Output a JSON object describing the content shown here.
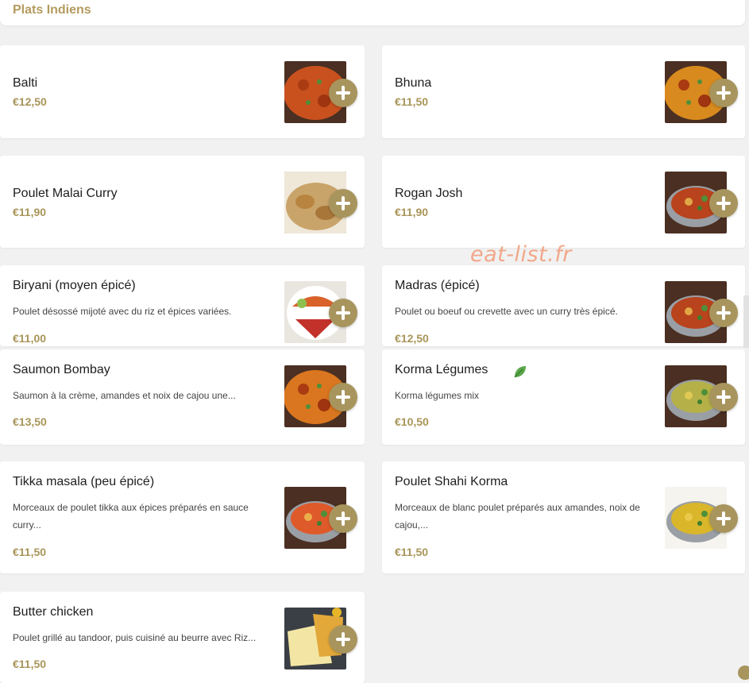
{
  "section": {
    "title": "Plats Indiens"
  },
  "watermark": "eat-list.fr",
  "dishes": [
    {
      "name": "Balti",
      "description": "",
      "price": "€12,50",
      "image": "curry-dish",
      "accent": "#c9511e"
    },
    {
      "name": "Bhuna",
      "description": "",
      "price": "€11,50",
      "image": "curry-dish",
      "accent": "#d88a1e"
    },
    {
      "name": "Poulet Malai Curry",
      "description": "",
      "price": "€11,90",
      "image": "creamy-chicken",
      "accent": "#c9a46a"
    },
    {
      "name": "Rogan Josh",
      "description": "",
      "price": "€11,90",
      "image": "curry-bowl",
      "accent": "#b8431c"
    },
    {
      "name": "Biryani (moyen épicé)",
      "description": "Poulet désossé mijoté avec du riz et épices variées.",
      "price": "€11,00",
      "image": "biryani-plate",
      "accent": "#d9622a"
    },
    {
      "name": "Madras (épicé)",
      "description": "Poulet ou boeuf ou crevette  avec un curry très épicé.",
      "price": "€12,50",
      "image": "curry-bowl",
      "accent": "#b8431c"
    },
    {
      "name": "Saumon Bombay",
      "description": "Saumon à la crème, amandes et noix de cajou une...",
      "price": "€13,50",
      "image": "salmon-curry",
      "accent": "#d9761f"
    },
    {
      "name": "Korma Légumes",
      "description": "Korma légumes mix",
      "price": "€10,50",
      "image": "korma-bowl",
      "accent": "#b5b148"
    },
    {
      "name": "Tikka masala (peu épicé)",
      "description": "Morceaux de poulet tikka aux épices préparés en sauce curry...",
      "price": "€11,50",
      "image": "tikka-bowl",
      "accent": "#de5a2a"
    },
    {
      "name": "Poulet Shahi Korma",
      "description": "Morceaux de blanc poulet préparés aux amandes, noix de cajou,...",
      "price": "€11,50",
      "image": "korma-pan",
      "accent": "#d9b62a"
    },
    {
      "name": "Butter chicken",
      "description": "Poulet grillé au tandoor, puis cuisiné au beurre avec Riz...",
      "price": "€11,50",
      "image": "butter-chicken",
      "accent": "#e2a83a"
    }
  ],
  "icons": {
    "add": "plus-icon",
    "vegetarian": "leaf-icon"
  },
  "colors": {
    "brand": "#a8955d",
    "price": "#a89558",
    "watermark": "#f2a07f",
    "background": "#f1f1f1"
  }
}
